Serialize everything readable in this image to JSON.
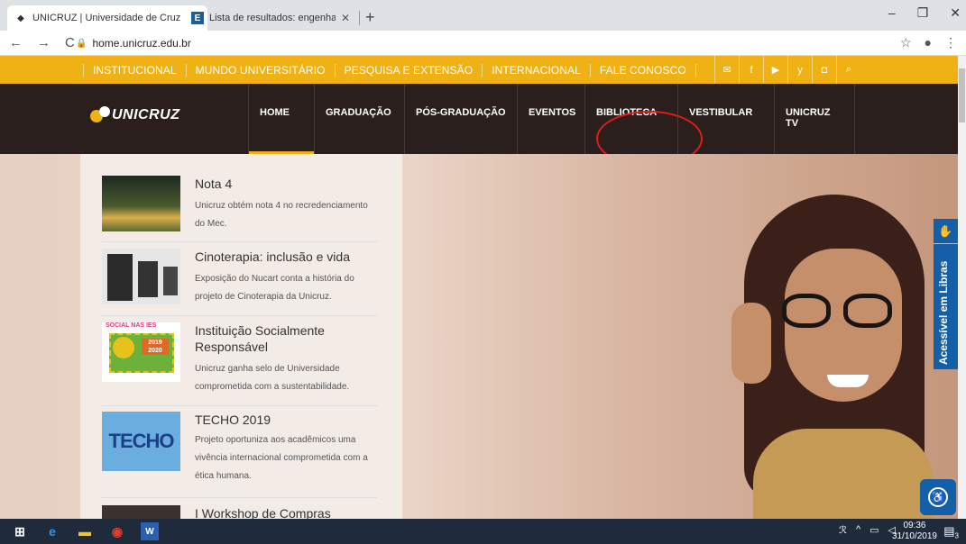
{
  "browser": {
    "tabs": [
      {
        "title": "UNICRUZ | Universidade de Cruz",
        "close": "✕"
      },
      {
        "title": "Lista de resultados: engenharia c",
        "close": "✕"
      }
    ],
    "new_tab": "+",
    "window_buttons": {
      "minimize": "–",
      "maximize": "❐",
      "close": "✕"
    },
    "nav": {
      "back": "←",
      "forward": "→",
      "reload": "C"
    },
    "url": "home.unicruz.edu.br",
    "right_icons": {
      "star": "☆",
      "profile": "●",
      "menu": "⋮"
    }
  },
  "site": {
    "topbar_links": [
      "INSTITUCIONAL",
      "MUNDO UNIVERSITÁRIO",
      "PESQUISA E EXTENSÃO",
      "INTERNACIONAL",
      "FALE CONOSCO"
    ],
    "social_icons": [
      "✉",
      "f",
      "▶",
      "y",
      "◘",
      "⌕"
    ],
    "logo_text": "UNICRUZ",
    "nav_items": [
      "HOME",
      "GRADUAÇÃO",
      "PÓS-GRADUAÇÃO",
      "EVENTOS",
      "BIBLIOTECA",
      "VESTIBULAR",
      "UNICRUZ TV"
    ],
    "news": [
      {
        "title": "Nota 4",
        "desc": "Unicruz obtém nota 4 no recredenciamento do Mec."
      },
      {
        "title": "Cinoterapia: inclusão e vida",
        "desc": "Exposição do Nucart conta a história do projeto de Cinoterapia da Unicruz."
      },
      {
        "title": "Instituição Socialmente Responsável",
        "desc": "Unicruz ganha selo de Universidade comprometida com a sustentabilidade."
      },
      {
        "title": "TECHO 2019",
        "desc": "Projeto oportuniza aos acadêmicos uma vivência internacional comprometida com a ética humana."
      },
      {
        "title": "I Workshop de Compras",
        "desc": ""
      }
    ],
    "thumb_texts": {
      "social": "SOCIAL NAS IES",
      "years": "2019 2020",
      "techo": "TECHO"
    },
    "libras": "Acessível em Libras"
  },
  "taskbar": {
    "time": "09:36",
    "date": "31/10/2019",
    "notif_count": "3"
  },
  "colors": {
    "accent": "#f0b114",
    "nav_bg": "#2b1f1d",
    "libras": "#1460a8",
    "highlight": "#e21b1b"
  }
}
